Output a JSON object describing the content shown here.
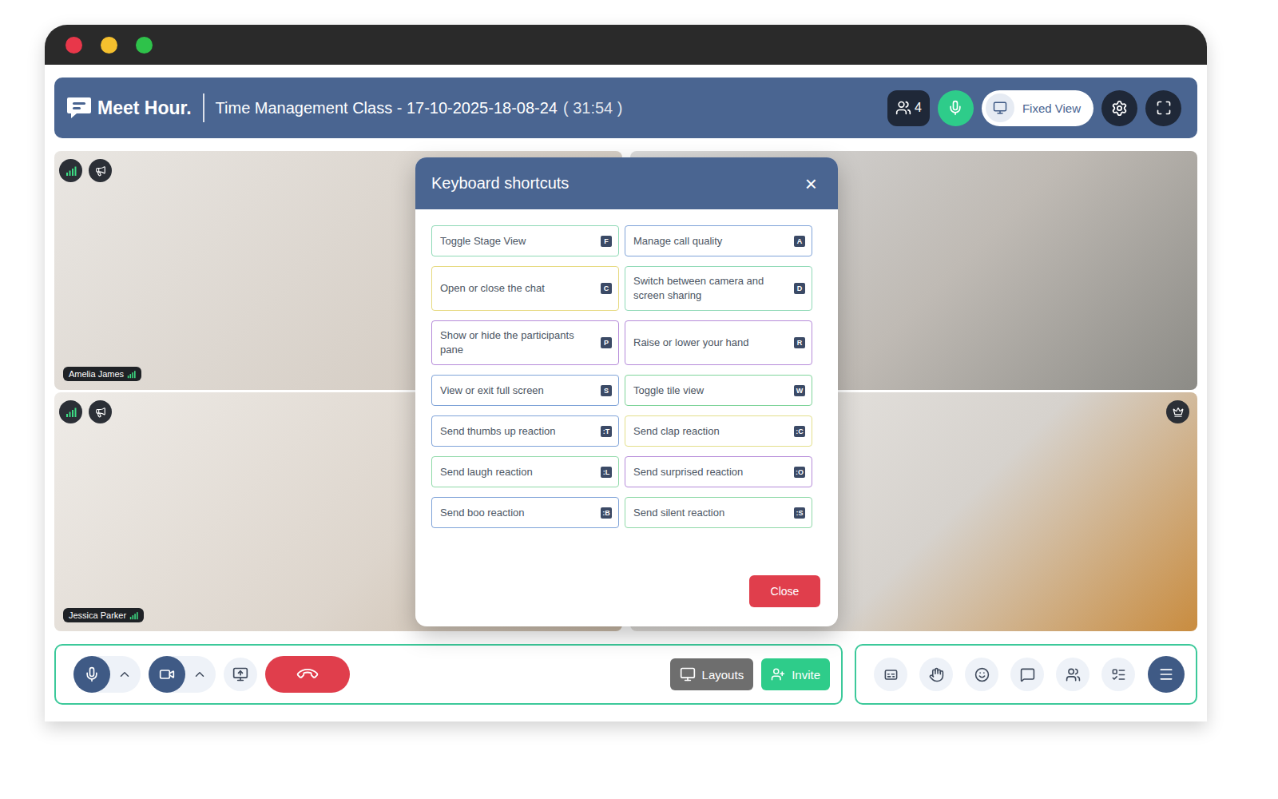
{
  "header": {
    "logo": "Meet Hour.",
    "meeting_title": "Time Management Class - 17-10-2025-18-08-24",
    "timer": "( 31:54 )",
    "participant_count": "4",
    "mic_active": true,
    "view_mode": "Fixed View"
  },
  "tiles": [
    {
      "name": "Amelia James",
      "indicators": true,
      "moderator": false
    },
    {
      "name": null,
      "indicators": false,
      "moderator": false
    },
    {
      "name": "Jessica Parker",
      "indicators": true,
      "moderator": false
    },
    {
      "name": null,
      "indicators": false,
      "moderator": true
    }
  ],
  "shortcuts_dialog": {
    "title": "Keyboard shortcuts",
    "close_icon": "×",
    "close_button": "Close",
    "items": [
      {
        "label": "Toggle Stage View",
        "key": "F",
        "color": "#8fd9b6"
      },
      {
        "label": "Manage call quality",
        "key": "A",
        "color": "#7fa3d8"
      },
      {
        "label": "Open or close the chat",
        "key": "C",
        "color": "#e6d97f"
      },
      {
        "label": "Switch between camera and screen sharing",
        "key": "D",
        "color": "#8fd9b6"
      },
      {
        "label": "Show or hide the participants pane",
        "key": "P",
        "color": "#b58ad9"
      },
      {
        "label": "Raise or lower your hand",
        "key": "R",
        "color": "#b58ad9"
      },
      {
        "label": "View or exit full screen",
        "key": "S",
        "color": "#7fa3d8"
      },
      {
        "label": "Toggle tile view",
        "key": "W",
        "color": "#7fd49a"
      },
      {
        "label": "Send thumbs up reaction",
        "key": ":T",
        "color": "#7fa3d8"
      },
      {
        "label": "Send clap reaction",
        "key": ":C",
        "color": "#e3df8a"
      },
      {
        "label": "Send laugh reaction",
        "key": ":L",
        "color": "#8fd9a8"
      },
      {
        "label": "Send surprised reaction",
        "key": ":O",
        "color": "#b58ad9"
      },
      {
        "label": "Send boo reaction",
        "key": ":B",
        "color": "#7fa3d8"
      },
      {
        "label": "Send silent reaction",
        "key": ":S",
        "color": "#8fd9a8"
      }
    ]
  },
  "toolbar": {
    "mic_muted": false,
    "camera_off": false,
    "layouts": "Layouts",
    "invite": "Invite"
  }
}
